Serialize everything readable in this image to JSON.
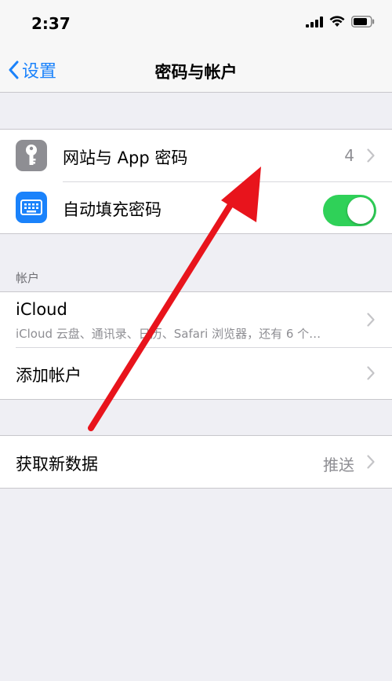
{
  "status": {
    "time": "2:37"
  },
  "nav": {
    "back_label": "设置",
    "title": "密码与帐户"
  },
  "group_passwords": {
    "items": [
      {
        "label": "网站与 App 密码",
        "value": "4",
        "icon": "key-icon"
      },
      {
        "label": "自动填充密码",
        "toggle": true,
        "icon": "keyboard-icon"
      }
    ]
  },
  "accounts": {
    "header": "帐户",
    "icloud": {
      "title": "iCloud",
      "subtitle": "iCloud 云盘、通讯录、日历、Safari 浏览器，还有 6 个…"
    },
    "add_account": "添加帐户"
  },
  "fetch": {
    "label": "获取新数据",
    "value": "推送"
  },
  "colors": {
    "accent": "#1a82fb",
    "toggle_on": "#2fd158",
    "annotation": "#e8141c"
  }
}
